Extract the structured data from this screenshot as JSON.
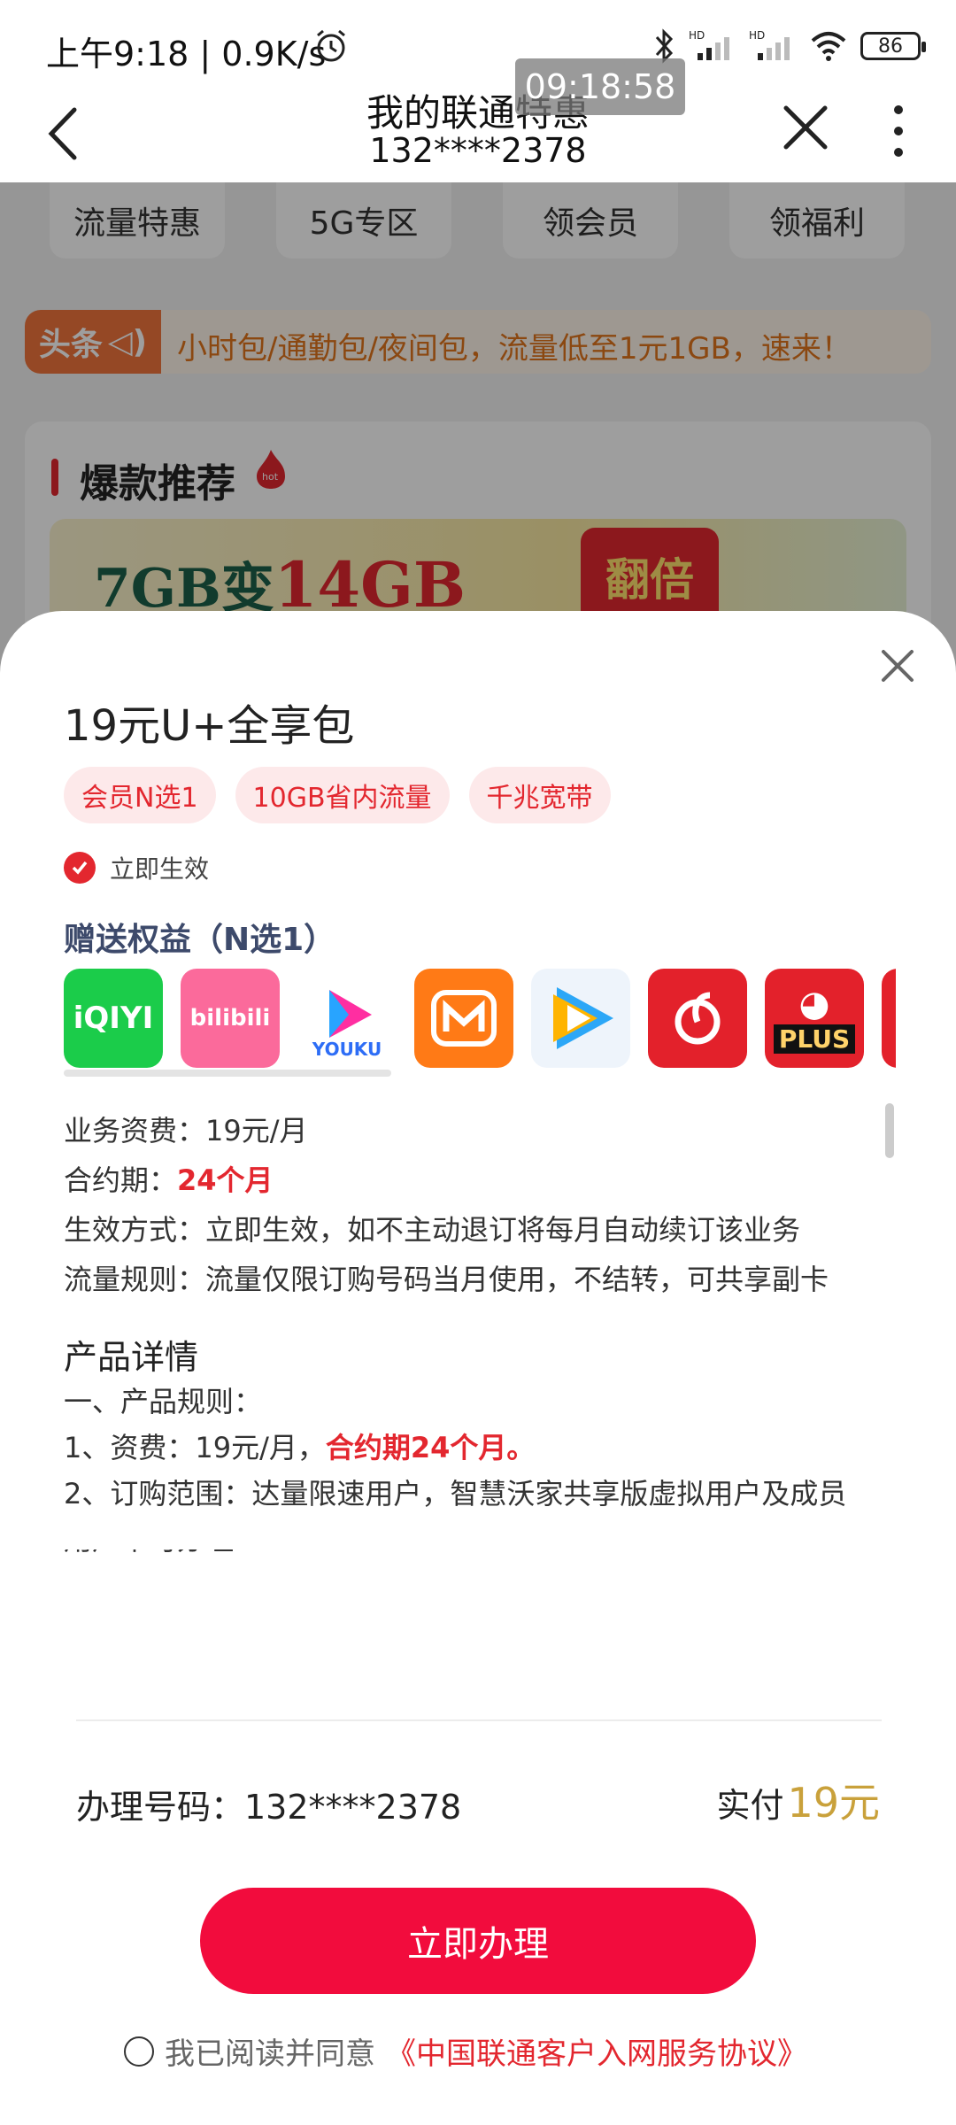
{
  "status_bar": {
    "time": "上午9:18 | 0.9K/s",
    "battery": "86",
    "overlay_clock": "09:18:58"
  },
  "nav": {
    "title": "我的联通特惠",
    "subtitle": "132****2378"
  },
  "background": {
    "quick_links": [
      "流量特惠",
      "5G专区",
      "领会员",
      "领福利"
    ],
    "ticker_tag": "头条",
    "ticker_text": "小时包/通勤包/夜间包，流量低至1元1GB，速来！",
    "section_title": "爆款推荐",
    "banner_prefix": "7GB变",
    "banner_em": "14GB",
    "banner_badge": "翻倍"
  },
  "sheet": {
    "product_title": "19元U+全享包",
    "tags": [
      "会员N选1",
      "10GB省内流量",
      "千兆宽带"
    ],
    "effect_label": "立即生效",
    "benefits_title": "赠送权益（N选1）",
    "apps": [
      {
        "name": "iQIYI",
        "icon": "iqiyi-icon"
      },
      {
        "name": "bilibili",
        "icon": "bilibili-icon"
      },
      {
        "name": "YOUKU",
        "icon": "youku-icon"
      },
      {
        "name": "Mango TV",
        "icon": "mangotv-icon"
      },
      {
        "name": "Tencent Video",
        "icon": "tencent-video-icon"
      },
      {
        "name": "NetEase Music",
        "icon": "netease-music-icon"
      },
      {
        "name": "PLUS",
        "icon": "jd-plus-icon"
      }
    ],
    "fee_label": "业务资费：",
    "fee_value": "19元/月",
    "contract_label": "合约期：",
    "contract_value": "24个月",
    "effect_mode": "生效方式：立即生效，如不主动退订将每月自动续订该业务",
    "traffic_rule": "流量规则：流量仅限订购号码当月使用，不结转，可共享副卡",
    "detail_title": "产品详情",
    "detail_lines": [
      "一、产品规则：",
      "1、资费：19元/月，",
      "2、订购范围：达量限速用户，智慧沃家共享版虚拟用户及成员",
      "用户不可办理"
    ],
    "detail_red": "合约期24个月。",
    "phone_label": "办理号码：132****2378",
    "paid_label": "实付",
    "paid_amount": "19元",
    "submit_label": "立即办理",
    "agree_text": "我已阅读并同意",
    "agree_link": "《中国联通客户入网服务协议》"
  },
  "colors": {
    "brand_red": "#e3272f",
    "button_red": "#f20c3d",
    "price_gold": "#c9a13b"
  }
}
